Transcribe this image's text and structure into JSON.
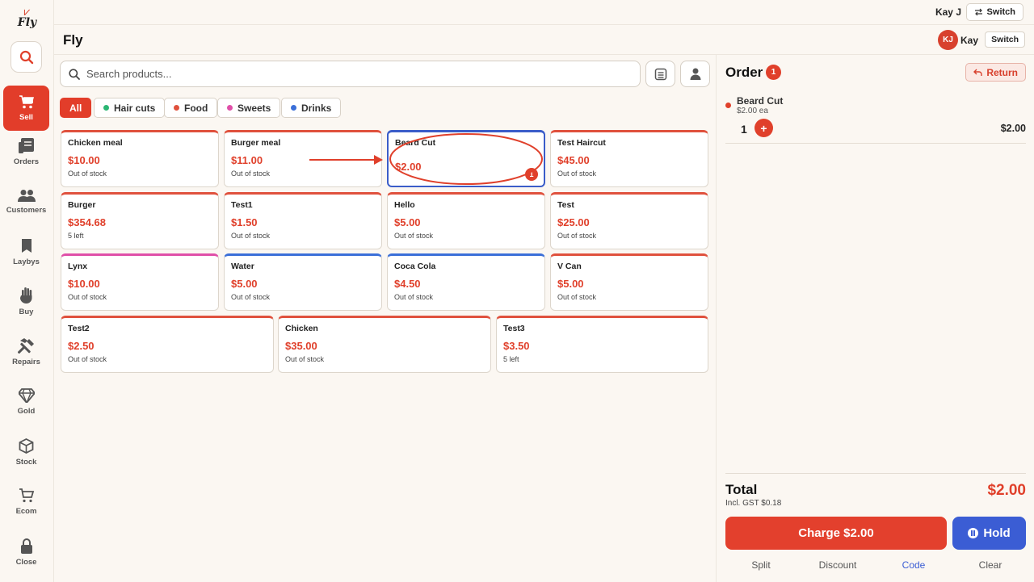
{
  "app": {
    "logo_text": "Fly",
    "page_title": "Fly"
  },
  "topbar": {
    "user": "Kay J",
    "switch_label": "Switch"
  },
  "header": {
    "avatar_initials": "KJ",
    "user": "Kay",
    "switch_label": "Switch"
  },
  "sidebar": {
    "items": [
      {
        "label": "Sell",
        "icon": "cart-icon",
        "active": true
      },
      {
        "label": "Orders",
        "icon": "orders-icon"
      },
      {
        "label": "Customers",
        "icon": "customers-icon"
      },
      {
        "label": "Laybys",
        "icon": "bookmark-icon"
      },
      {
        "label": "Buy",
        "icon": "hand-icon"
      },
      {
        "label": "Repairs",
        "icon": "hammer-icon"
      },
      {
        "label": "Gold",
        "icon": "diamond-icon"
      },
      {
        "label": "Stock",
        "icon": "box-icon"
      },
      {
        "label": "Ecom",
        "icon": "shopping-cart-outline-icon"
      },
      {
        "label": "Close",
        "icon": "lock-icon"
      }
    ]
  },
  "search": {
    "placeholder": "Search products..."
  },
  "categories": [
    {
      "label": "All",
      "active": true
    },
    {
      "label": "Hair cuts",
      "color": "#2bb673"
    },
    {
      "label": "Food",
      "color": "#e0513d"
    },
    {
      "label": "Sweets",
      "color": "#e04fa8"
    },
    {
      "label": "Drinks",
      "color": "#3b6fd8"
    }
  ],
  "products": [
    {
      "name": "Chicken meal",
      "price": "$10.00",
      "stock": "Out of stock",
      "color": "#e0513d"
    },
    {
      "name": "Burger meal",
      "price": "$11.00",
      "stock": "Out of stock",
      "color": "#e0513d"
    },
    {
      "name": "Beard Cut",
      "price": "$2.00",
      "stock": "",
      "color": "#3b5dc9",
      "selected": true,
      "qty": "1"
    },
    {
      "name": "Test Haircut",
      "price": "$45.00",
      "stock": "Out of stock",
      "color": "#e0513d"
    },
    {
      "name": "Burger",
      "price": "$354.68",
      "stock": "5 left",
      "color": "#e0513d"
    },
    {
      "name": "Test1",
      "price": "$1.50",
      "stock": "Out of stock",
      "color": "#e0513d"
    },
    {
      "name": "Hello",
      "price": "$5.00",
      "stock": "Out of stock",
      "color": "#e0513d"
    },
    {
      "name": "Test",
      "price": "$25.00",
      "stock": "Out of stock",
      "color": "#e0513d"
    },
    {
      "name": "Lynx",
      "price": "$10.00",
      "stock": "Out of stock",
      "color": "#e04fa8"
    },
    {
      "name": "Water",
      "price": "$5.00",
      "stock": "Out of stock",
      "color": "#3b6fd8"
    },
    {
      "name": "Coca Cola",
      "price": "$4.50",
      "stock": "Out of stock",
      "color": "#3b6fd8"
    },
    {
      "name": "V Can",
      "price": "$5.00",
      "stock": "Out of stock",
      "color": "#e0513d"
    },
    {
      "name": "Test2",
      "price": "$2.50",
      "stock": "Out of stock",
      "color": "#e0513d"
    },
    {
      "name": "Chicken",
      "price": "$35.00",
      "stock": "Out of stock",
      "color": "#e0513d"
    },
    {
      "name": "Test3",
      "price": "$3.50",
      "stock": "5 left",
      "color": "#e0513d"
    }
  ],
  "order": {
    "title": "Order",
    "count": "1",
    "return_label": "Return",
    "items": [
      {
        "name": "Beard Cut",
        "each": "$2.00 ea",
        "qty": "1",
        "total": "$2.00"
      }
    ],
    "total_label": "Total",
    "gst_label": "Incl. GST $0.18",
    "total_value": "$2.00",
    "charge_label": "Charge $2.00",
    "hold_label": "Hold",
    "footer_links": [
      "Split",
      "Discount",
      "Code",
      "Clear"
    ]
  },
  "colors": {
    "accent": "#e23d2a",
    "hold": "#3b5dd4",
    "selected_border": "#3b5dc9"
  }
}
